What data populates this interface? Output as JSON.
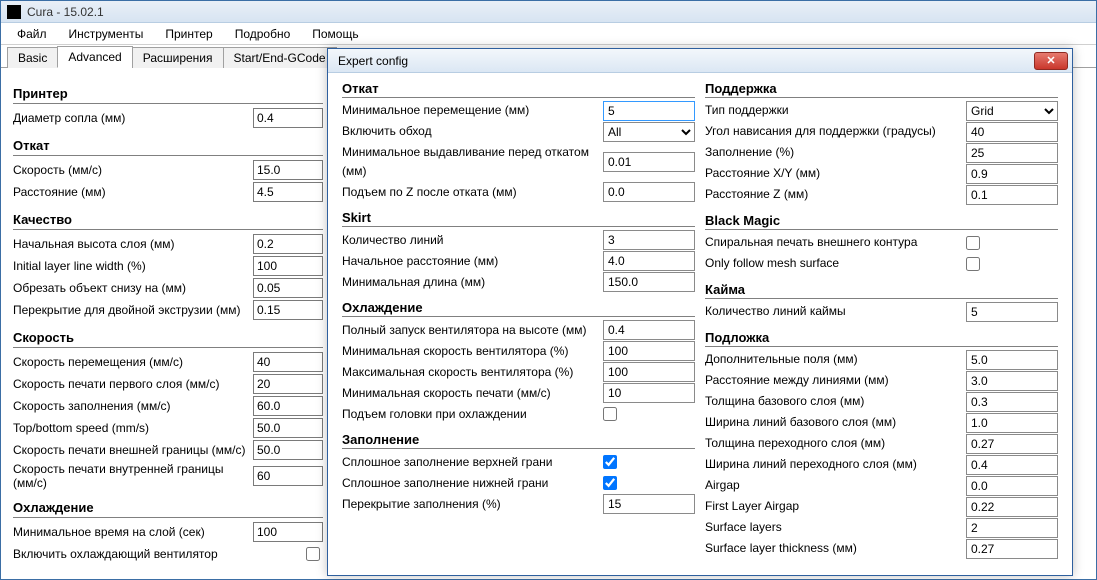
{
  "titlebar": {
    "title": "Cura - 15.02.1"
  },
  "menubar": [
    "Файл",
    "Инструменты",
    "Принтер",
    "Подробно",
    "Помощь"
  ],
  "tabs": [
    "Basic",
    "Advanced",
    "Расширения",
    "Start/End-GCode"
  ],
  "active_tab": "Advanced",
  "panel": {
    "printer": {
      "hdr": "Принтер",
      "nozzle_dia": {
        "label": "Диаметр сопла (мм)",
        "value": "0.4"
      }
    },
    "retract": {
      "hdr": "Откат",
      "speed": {
        "label": "Скорость (мм/с)",
        "value": "15.0"
      },
      "distance": {
        "label": "Расстояние (мм)",
        "value": "4.5"
      }
    },
    "quality": {
      "hdr": "Качество",
      "init_layer_h": {
        "label": "Начальная высота слоя (мм)",
        "value": "0.2"
      },
      "init_line_w": {
        "label": "Initial layer line width (%)",
        "value": "100"
      },
      "cut_bottom": {
        "label": "Обрезать объект снизу на (мм)",
        "value": "0.05"
      },
      "dual_overlap": {
        "label": "Перекрытие для двойной экструзии (мм)",
        "value": "0.15"
      }
    },
    "speed": {
      "hdr": "Скорость",
      "travel": {
        "label": "Скорость перемещения (мм/с)",
        "value": "40"
      },
      "first_layer": {
        "label": "Скорость печати первого слоя (мм/с)",
        "value": "20"
      },
      "infill": {
        "label": "Скорость заполнения (мм/с)",
        "value": "60.0"
      },
      "topbottom": {
        "label": "Top/bottom speed (mm/s)",
        "value": "50.0"
      },
      "outer": {
        "label": "Скорость печати внешней границы (мм/с)",
        "value": "50.0"
      },
      "inner": {
        "label": "Скорость печати внутренней границы (мм/с)",
        "value": "60"
      }
    },
    "cool": {
      "hdr": "Охлаждение",
      "min_layer_time": {
        "label": "Минимальное время на слой (сек)",
        "value": "100"
      },
      "fan_enable": {
        "label": "Включить охлаждающий вентилятор",
        "checked": false
      }
    }
  },
  "dialog": {
    "title": "Expert config",
    "left": {
      "retract": {
        "hdr": "Откат",
        "min_travel": {
          "label": "Минимальное перемещение (мм)",
          "value": "5"
        },
        "combing": {
          "label": "Включить обход",
          "value": "All"
        },
        "min_extrude": {
          "label": "Минимальное выдавливание перед откатом (мм)",
          "value": "0.01"
        },
        "zhop": {
          "label": "Подъем по Z после отката (мм)",
          "value": "0.0"
        }
      },
      "skirt": {
        "hdr": "Skirt",
        "lines": {
          "label": "Количество линий",
          "value": "3"
        },
        "start_dist": {
          "label": "Начальное расстояние (мм)",
          "value": "4.0"
        },
        "min_len": {
          "label": "Минимальная длина (мм)",
          "value": "150.0"
        }
      },
      "cool": {
        "hdr": "Охлаждение",
        "fan_full_h": {
          "label": "Полный запуск вентилятора на высоте (мм)",
          "value": "0.4"
        },
        "fan_min": {
          "label": "Минимальная скорость вентилятора (%)",
          "value": "100"
        },
        "fan_max": {
          "label": "Максимальная скорость вентилятора (%)",
          "value": "100"
        },
        "min_speed": {
          "label": "Минимальная скорость печати (мм/с)",
          "value": "10"
        },
        "head_lift": {
          "label": "Подъем головки при охлаждении",
          "checked": false
        }
      },
      "infill": {
        "hdr": "Заполнение",
        "solid_top": {
          "label": "Сплошное заполнение верхней грани",
          "checked": true
        },
        "solid_bot": {
          "label": "Сплошное заполнение нижней грани",
          "checked": true
        },
        "overlap": {
          "label": "Перекрытие заполнения (%)",
          "value": "15"
        }
      }
    },
    "right": {
      "support": {
        "hdr": "Поддержка",
        "type": {
          "label": "Тип поддержки",
          "value": "Grid"
        },
        "angle": {
          "label": "Угол нависания для поддержки (градусы)",
          "value": "40"
        },
        "fill": {
          "label": "Заполнение (%)",
          "value": "25"
        },
        "dist_xy": {
          "label": "Расстояние X/Y (мм)",
          "value": "0.9"
        },
        "dist_z": {
          "label": "Расстояние Z (мм)",
          "value": "0.1"
        }
      },
      "blackmagic": {
        "hdr": "Black Magic",
        "spiralize": {
          "label": "Спиральная печать внешнего контура",
          "checked": false
        },
        "mesh_only": {
          "label": "Only follow mesh surface",
          "checked": false
        }
      },
      "brim": {
        "hdr": "Кайма",
        "lines": {
          "label": "Количество линий каймы",
          "value": "5"
        }
      },
      "raft": {
        "hdr": "Подложка",
        "margin": {
          "label": "Дополнительные поля (мм)",
          "value": "5.0"
        },
        "line_space": {
          "label": "Расстояние между линиями (мм)",
          "value": "3.0"
        },
        "base_thick": {
          "label": "Толщина базового слоя (мм)",
          "value": "0.3"
        },
        "base_line_w": {
          "label": "Ширина линий базового слоя (мм)",
          "value": "1.0"
        },
        "interf_thick": {
          "label": "Толщина переходного слоя (мм)",
          "value": "0.27"
        },
        "interf_line_w": {
          "label": "Ширина линий переходного слоя (мм)",
          "value": "0.4"
        },
        "airgap": {
          "label": "Airgap",
          "value": "0.0"
        },
        "first_airgap": {
          "label": "First Layer Airgap",
          "value": "0.22"
        },
        "surf_layers": {
          "label": "Surface layers",
          "value": "2"
        },
        "surf_layer_thick": {
          "label": "Surface layer thickness (мм)",
          "value": "0.27"
        }
      }
    }
  }
}
